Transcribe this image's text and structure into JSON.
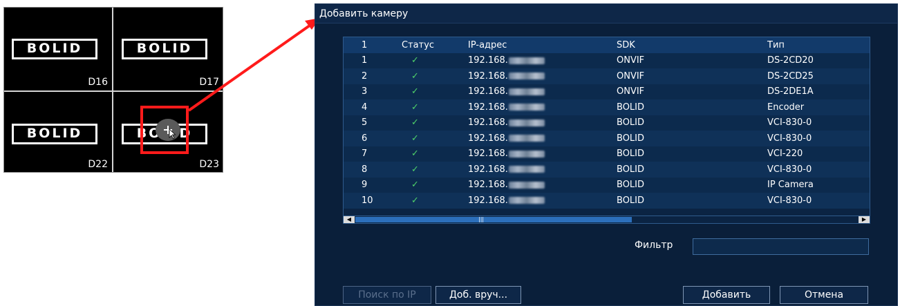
{
  "camera_grid": {
    "logo_text": "BOLID",
    "tiles": [
      {
        "label": "D16"
      },
      {
        "label": "D17"
      },
      {
        "label": "D22"
      },
      {
        "label": "D23"
      }
    ]
  },
  "dialog": {
    "title": "Добавить камеру",
    "columns": [
      "1",
      "Статус",
      "IP-адрес",
      "SDK",
      "Тип"
    ],
    "rows": [
      {
        "num": "1",
        "status": "✓",
        "ip": "192.168.",
        "sdk": "ONVIF",
        "type": "DS-2CD20"
      },
      {
        "num": "2",
        "status": "✓",
        "ip": "192.168.",
        "sdk": "ONVIF",
        "type": "DS-2CD25"
      },
      {
        "num": "3",
        "status": "✓",
        "ip": "192.168.",
        "sdk": "ONVIF",
        "type": "DS-2DE1A"
      },
      {
        "num": "4",
        "status": "✓",
        "ip": "192.168.",
        "sdk": "BOLID",
        "type": "Encoder"
      },
      {
        "num": "5",
        "status": "✓",
        "ip": "192.168.",
        "sdk": "BOLID",
        "type": "VCI-830-0"
      },
      {
        "num": "6",
        "status": "✓",
        "ip": "192.168.",
        "sdk": "BOLID",
        "type": "VCI-830-0"
      },
      {
        "num": "7",
        "status": "✓",
        "ip": "192.168.",
        "sdk": "BOLID",
        "type": "VCI-220"
      },
      {
        "num": "8",
        "status": "✓",
        "ip": "192.168.",
        "sdk": "BOLID",
        "type": "VCI-830-0"
      },
      {
        "num": "9",
        "status": "✓",
        "ip": "192.168.",
        "sdk": "BOLID",
        "type": "IP Camera"
      },
      {
        "num": "10",
        "status": "✓",
        "ip": "192.168.",
        "sdk": "BOLID",
        "type": "VCI-830-0"
      }
    ],
    "filter_label": "Фильтр",
    "filter_value": "",
    "buttons": {
      "search_ip": "Поиск по IP",
      "add_manual": "Доб. вруч...",
      "add": "Добавить",
      "cancel": "Отмена"
    }
  },
  "colors": {
    "dialog_bg": "#0a1f3a",
    "highlight": "#ff1b1b",
    "status_ok": "#4fd36a"
  }
}
